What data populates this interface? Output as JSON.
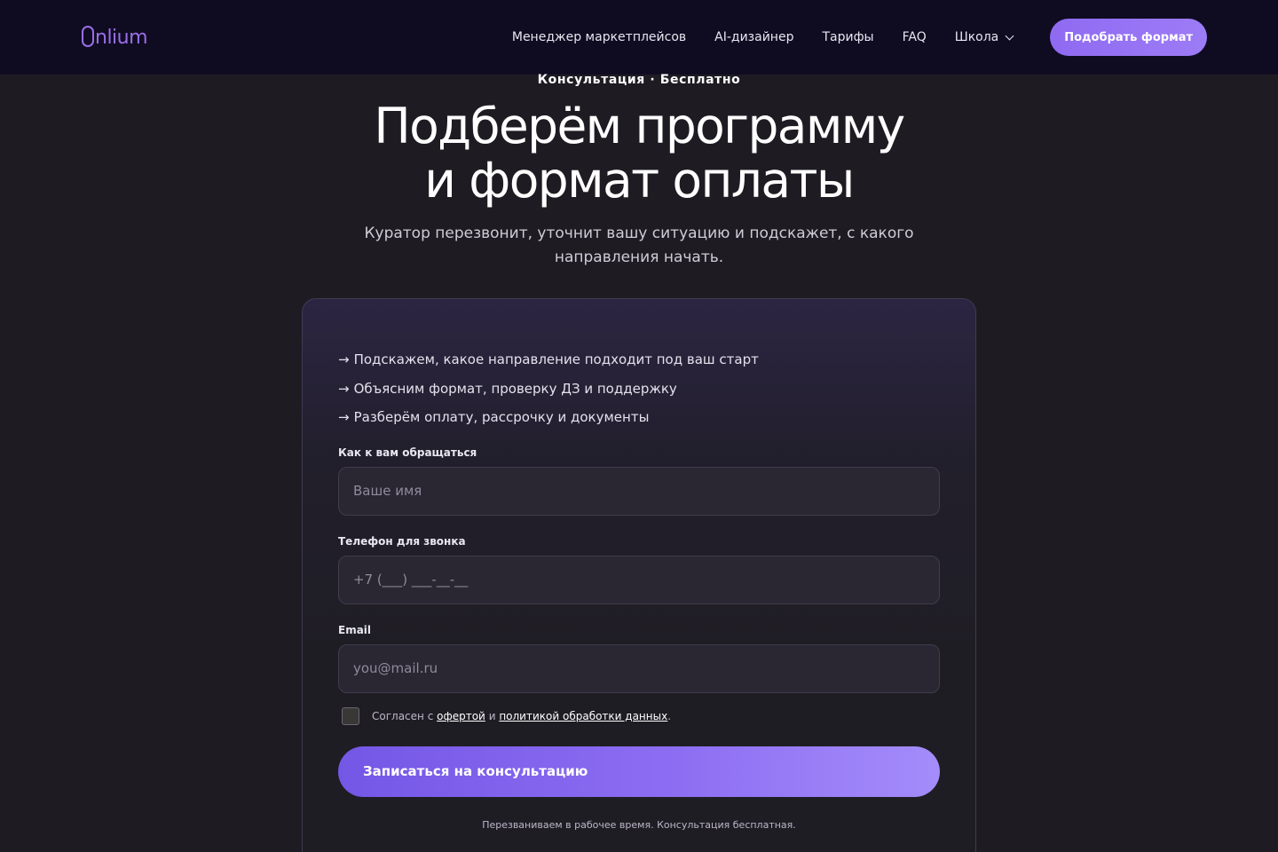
{
  "header": {
    "logo_text": "nlium",
    "nav": [
      {
        "label": "Менеджер маркетплейсов"
      },
      {
        "label": "AI-дизайнер"
      },
      {
        "label": "Тарифы"
      },
      {
        "label": "FAQ"
      },
      {
        "label": "Школа"
      }
    ],
    "cta_label": "Подобрать формат"
  },
  "hero": {
    "eyebrow": "Консультация · Бесплатно",
    "title_line1": "Подберём программу",
    "title_line2": "и формат оплаты",
    "subtitle": "Куратор перезвонит, уточнит вашу ситуацию и подскажет, с какого направления начать."
  },
  "form": {
    "perks": [
      "Подскажем, какое направление подходит под ваш старт",
      "Объясним формат, проверку ДЗ и поддержку",
      "Разберём оплату, рассрочку и документы"
    ],
    "perk_arrow": "→",
    "name_label": "Как к вам обращаться",
    "name_placeholder": "Ваше имя",
    "name_value": "",
    "phone_label": "Телефон для звонка",
    "phone_placeholder": "+7 (___) ___-__-__",
    "phone_value": "",
    "email_label": "Email",
    "email_placeholder": "you@mail.ru",
    "email_value": "",
    "consent_prefix": "Согласен с",
    "consent_offer_link": "офертой",
    "consent_and": "и",
    "consent_policy_link": "политикой обработки данных",
    "consent_suffix": ".",
    "consent_checked": false,
    "submit_label": "Записаться на консультацию",
    "note": "Перезваниваем в рабочее время. Консультация бесплатная."
  },
  "colors": {
    "accent": "#8f6af2",
    "header_bg": "#0f0c22",
    "page_bg": "#1e1c22",
    "logo": "#9b6ee8"
  }
}
